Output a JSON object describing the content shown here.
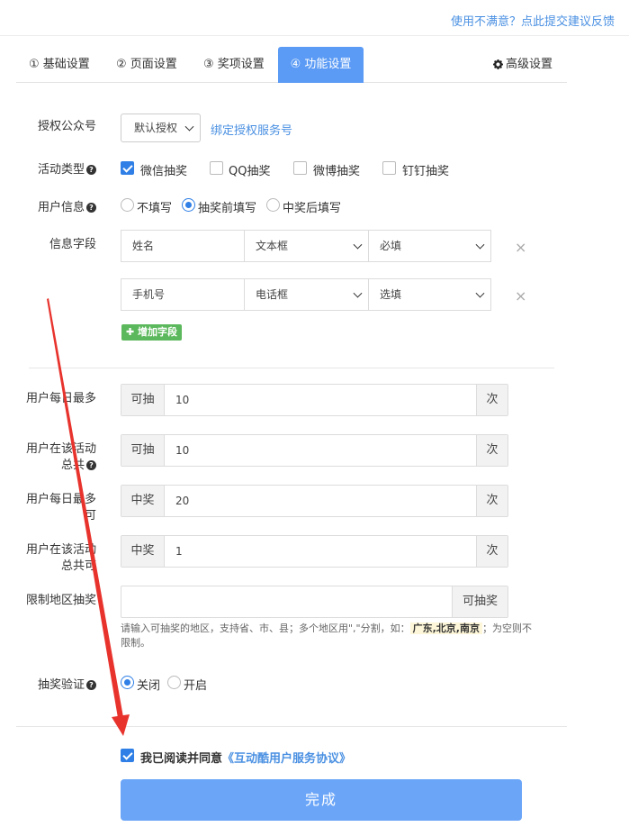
{
  "header": {
    "feedback_link": "使用不满意？点此提交建议反馈"
  },
  "tabs": [
    {
      "label": "① 基础设置"
    },
    {
      "label": "② 页面设置"
    },
    {
      "label": "③ 奖项设置"
    },
    {
      "label": "④ 功能设置"
    }
  ],
  "tab_advanced": {
    "label": "高级设置",
    "icon": "gear-icon"
  },
  "auth": {
    "label": "授权公众号",
    "select_value": "默认授权",
    "link": "绑定授权服务号"
  },
  "activity_type": {
    "label": "活动类型",
    "options": [
      {
        "label": "微信抽奖",
        "checked": true
      },
      {
        "label": "QQ抽奖",
        "checked": false
      },
      {
        "label": "微博抽奖",
        "checked": false
      },
      {
        "label": "钉钉抽奖",
        "checked": false
      }
    ]
  },
  "user_info": {
    "label": "用户信息",
    "options": [
      {
        "label": "不填写",
        "selected": false
      },
      {
        "label": "抽奖前填写",
        "selected": true
      },
      {
        "label": "中奖后填写",
        "selected": false
      }
    ]
  },
  "info_fields": {
    "label": "信息字段",
    "rows": [
      {
        "name": "姓名",
        "type": "文本框",
        "required": "必填"
      },
      {
        "name": "手机号",
        "type": "电话框",
        "required": "选填"
      }
    ],
    "delete_glyph": "×",
    "add_button": "增加字段"
  },
  "limits": [
    {
      "label": "用户每日最多",
      "prefix": "可抽",
      "value": "10",
      "suffix": "次"
    },
    {
      "label": "用户在该活动总共",
      "prefix": "可抽",
      "value": "10",
      "suffix": "次"
    },
    {
      "label": "用户每日最多可",
      "prefix": "中奖",
      "value": "20",
      "suffix": "次"
    },
    {
      "label": "用户在该活动总共可",
      "prefix": "中奖",
      "value": "1",
      "suffix": "次"
    }
  ],
  "region": {
    "label": "限制地区抽奖",
    "suffix": "可抽奖",
    "hint_before": "请输入可抽奖的地区，支持省、市、县；多个地区用\",\"分割，如：",
    "hint_example": "广东,北京,南京",
    "hint_after": "；为空则不限制。"
  },
  "verify": {
    "label": "抽奖验证",
    "options": [
      {
        "label": "关闭",
        "selected": true
      },
      {
        "label": "开启",
        "selected": false
      }
    ]
  },
  "agreement": {
    "text": "我已阅读并同意",
    "link": "《互动酷用户服务协议》",
    "checked": true
  },
  "submit": {
    "label": "完成"
  },
  "colors": {
    "primary": "#5b9bf5",
    "link": "#4a90e2",
    "add_green": "#5cb85c",
    "arrow_red": "#e8332d"
  }
}
